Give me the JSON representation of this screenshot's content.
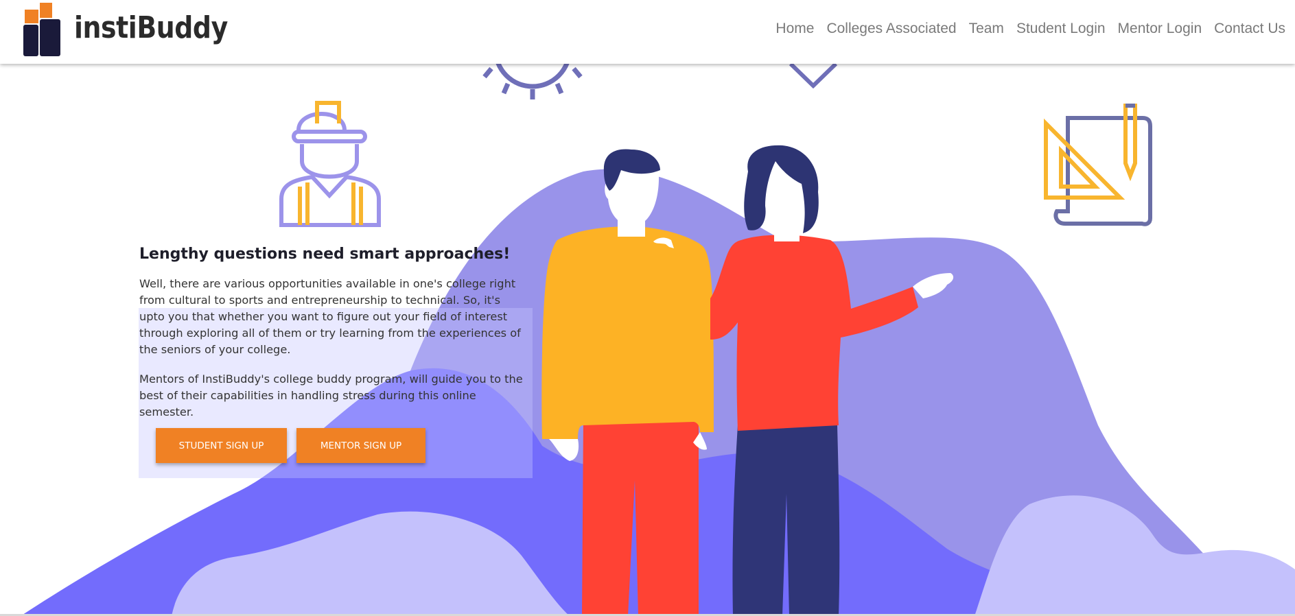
{
  "brand": {
    "name": "instiBuddy",
    "colors": {
      "orange": "#f08124",
      "navy": "#1a1a3a"
    }
  },
  "nav": {
    "items": [
      "Home",
      "Colleges Associated",
      "Team",
      "Student Login",
      "Mentor Login",
      "Contact Us"
    ]
  },
  "hero": {
    "title": "Lengthy questions need smart approaches!",
    "paragraph1": "Well, there are various opportunities available in one's college right from cultural to sports and entrepreneurship to technical. So, it's upto you that whether you want to figure out your field of interest through exploring all of them or try learning from the experiences of the seniors of your college.",
    "paragraph2": "Mentors of InstiBuddy's college buddy program, will guide you to the best of their capabilities in handling stress during this online semester.",
    "student_signup_label": "STUDENT SIGN UP",
    "mentor_signup_label": "MENTOR SIGN UP"
  },
  "illustration": {
    "icons": [
      "gear-icon",
      "diamond-icon",
      "engineer-icon",
      "blueprint-icon"
    ],
    "colors": {
      "mountain_back": "#9993ea",
      "mountain_front": "#736cfc",
      "hills_light": "#c4c1fc",
      "man_shirt": "#fdb225",
      "man_pants": "#ff4234",
      "woman_shirt": "#ff4234",
      "woman_pants": "#2f3577",
      "hair": "#2d3473",
      "icon_purple": "#9c93ea",
      "icon_yellow": "#f8b52e"
    }
  }
}
